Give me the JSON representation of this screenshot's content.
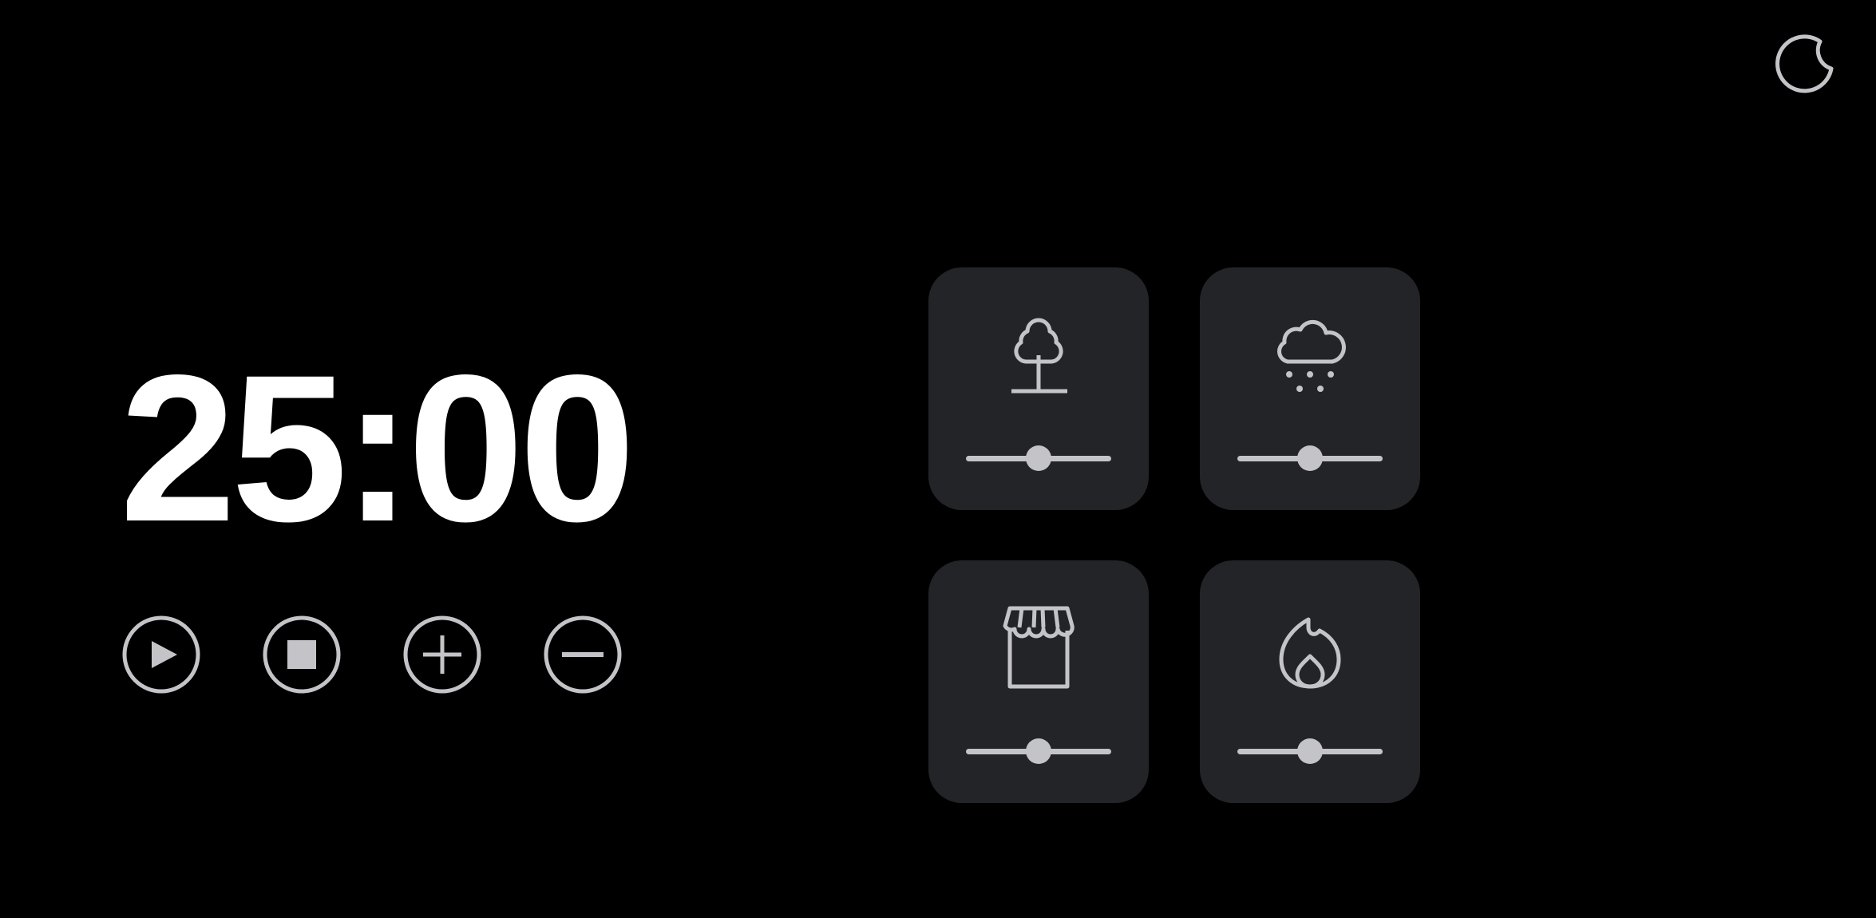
{
  "timer": {
    "display": "25:00"
  },
  "header": {
    "theme_toggle_icon": "moon-icon"
  },
  "controls": [
    {
      "action": "play",
      "icon": "play-icon"
    },
    {
      "action": "stop",
      "icon": "stop-icon"
    },
    {
      "action": "increase",
      "icon": "plus-icon"
    },
    {
      "action": "decrease",
      "icon": "minus-icon"
    }
  ],
  "sounds": [
    {
      "icon": "tree-icon",
      "volume": 0.5
    },
    {
      "icon": "rain-cloud-icon",
      "volume": 0.5
    },
    {
      "icon": "storefront-icon",
      "volume": 0.5
    },
    {
      "icon": "fire-icon",
      "volume": 0.5
    }
  ],
  "colors": {
    "background": "#000000",
    "card": "#232427",
    "icon": "#c4c4c8",
    "timer_text": "#ffffff"
  }
}
